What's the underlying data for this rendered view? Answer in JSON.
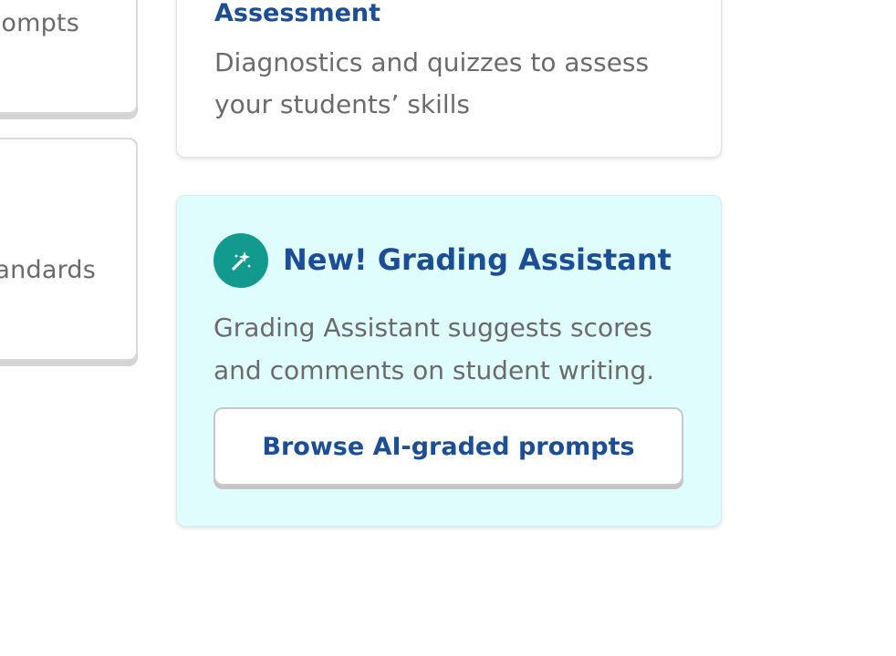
{
  "left_cards": {
    "top_snippet": "ompts",
    "bottom_snippet": "andards"
  },
  "assessment_card": {
    "title": "Assessment",
    "description": "Diagnostics and quizzes to assess your students’ skills"
  },
  "grading_card": {
    "icon": "magic-wand-icon",
    "title": "New! Grading Assistant",
    "description": "Grading Assistant suggests scores and comments on student writing.",
    "button_label": "Browse AI-graded prompts"
  },
  "colors": {
    "heading_blue": "#1c4e96",
    "body_gray": "#6b6b6b",
    "teal_icon_bg": "#139a8f",
    "grading_card_bg": "#e0fdfe"
  }
}
